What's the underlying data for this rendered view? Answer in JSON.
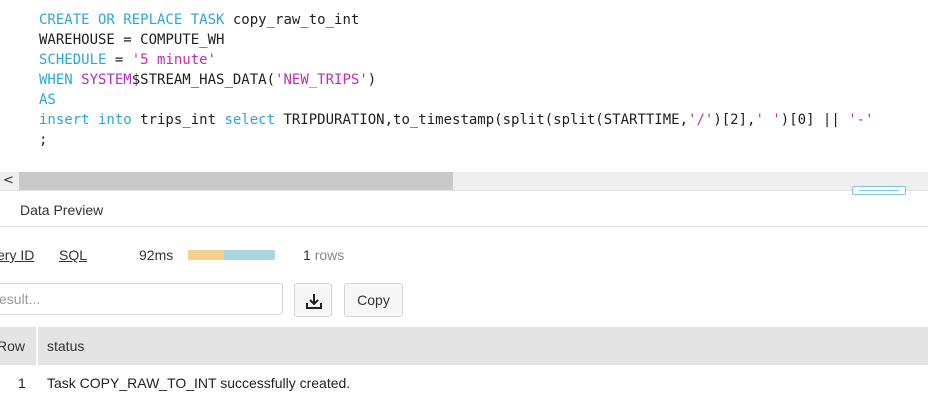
{
  "editor": {
    "lines": [
      [
        {
          "t": "CREATE OR REPLACE TASK",
          "c": "kw"
        },
        {
          "t": " copy_raw_to_int",
          "c": ""
        }
      ],
      [
        {
          "t": "WAREHOUSE = COMPUTE_WH",
          "c": ""
        }
      ],
      [
        {
          "t": "SCHEDULE",
          "c": "kw"
        },
        {
          "t": " = ",
          "c": ""
        },
        {
          "t": "'5 minute'",
          "c": "str"
        }
      ],
      [
        {
          "t": "WHEN ",
          "c": "kw"
        },
        {
          "t": "SYSTEM",
          "c": "fn"
        },
        {
          "t": "$STREAM_HAS_DATA(",
          "c": ""
        },
        {
          "t": "'NEW_TRIPS'",
          "c": "str"
        },
        {
          "t": ")",
          "c": ""
        }
      ],
      [
        {
          "t": "AS",
          "c": "kw"
        }
      ],
      [
        {
          "t": "insert into",
          "c": "kw"
        },
        {
          "t": " trips_int ",
          "c": ""
        },
        {
          "t": "select",
          "c": "kw"
        },
        {
          "t": " TRIPDURATION,to_timestamp(split(split(STARTTIME,",
          "c": ""
        },
        {
          "t": "'/'",
          "c": "str"
        },
        {
          "t": ")[2],",
          "c": ""
        },
        {
          "t": "' '",
          "c": "str"
        },
        {
          "t": ")[0] || ",
          "c": ""
        },
        {
          "t": "'-'",
          "c": "str"
        }
      ],
      [
        {
          "t": ";",
          "c": ""
        }
      ]
    ],
    "scroll_left_icon": "chevron-left-icon",
    "scroll_left_glyph": "<"
  },
  "results": {
    "panel_title": "Data Preview",
    "query_id_link": "ery ID",
    "sql_link": "SQL",
    "duration": "92ms",
    "progress_first_fraction": 0.41,
    "rows_count": "1",
    "rows_unit": "rows",
    "filter_placeholder": "esult...",
    "download_icon": "download-icon",
    "copy_label": "Copy",
    "columns": [
      "Row",
      "status"
    ],
    "row": {
      "num": "1",
      "status": "Task COPY_RAW_TO_INT successfully created."
    }
  },
  "colors": {
    "keyword": "#2ea6d4",
    "function": "#b02fbf",
    "string": "#c42bb0",
    "progress_compile": "#f5d08e",
    "progress_exec": "#a8d7de"
  }
}
